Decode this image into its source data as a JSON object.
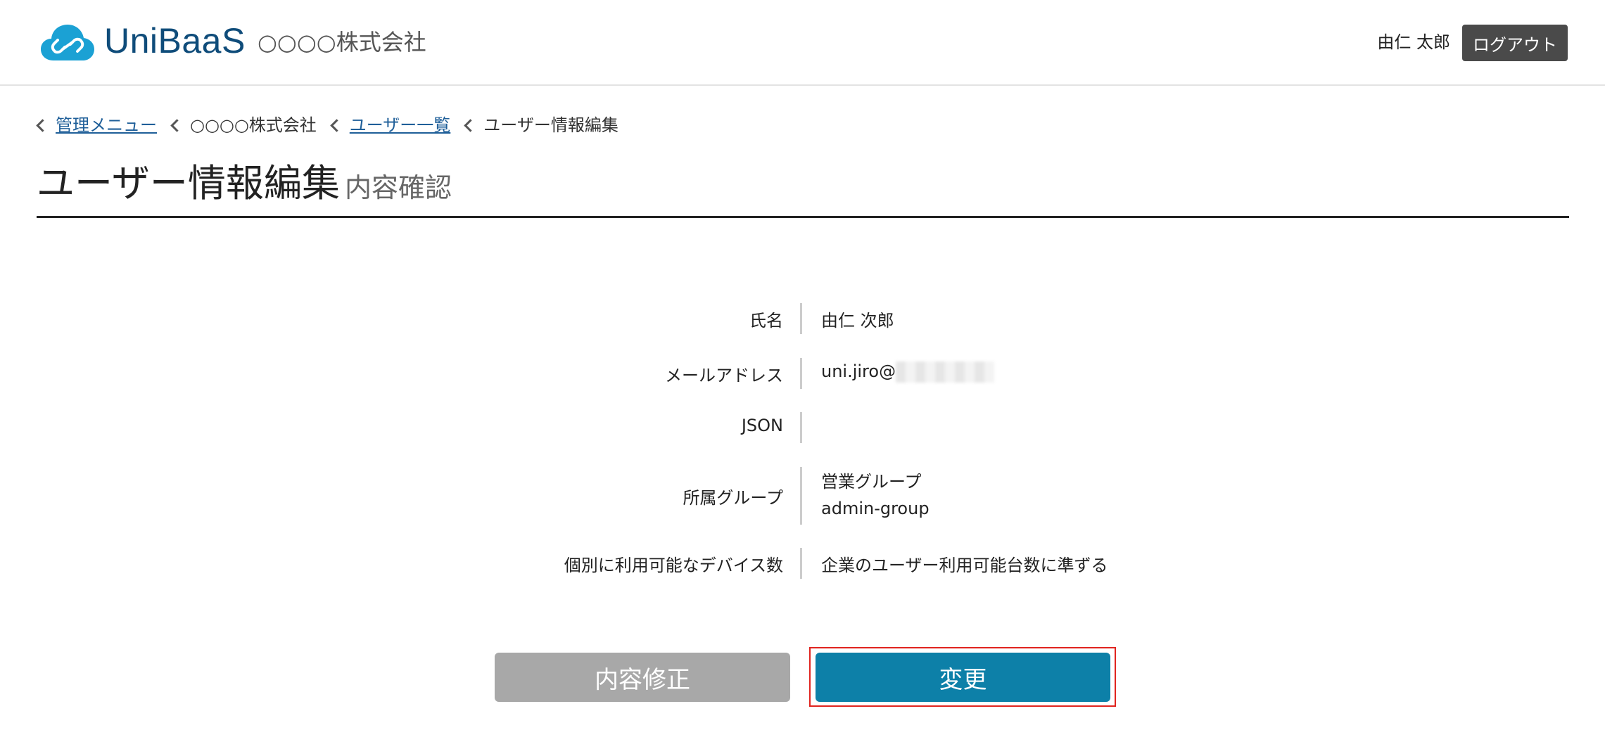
{
  "header": {
    "brand": "UniBaaS",
    "company": "○○○○株式会社",
    "user_name": "由仁 太郎",
    "logout_label": "ログアウト",
    "logo_icon": "cloud-link-icon",
    "brand_color": "#0f4c7a",
    "logo_color": "#1ba1d4"
  },
  "breadcrumb": [
    {
      "label": "管理メニュー",
      "link": true
    },
    {
      "label": "○○○○株式会社",
      "link": false
    },
    {
      "label": "ユーザー一覧",
      "link": true
    },
    {
      "label": "ユーザー情報編集",
      "link": false
    }
  ],
  "page": {
    "title": "ユーザー情報編集",
    "subtitle": "内容確認"
  },
  "details": {
    "name": {
      "label": "氏名",
      "value": "由仁 次郎"
    },
    "email": {
      "label": "メールアドレス",
      "value": "uni.jiro@"
    },
    "json": {
      "label": "JSON",
      "value": ""
    },
    "groups": {
      "label": "所属グループ",
      "values": [
        "営業グループ",
        "admin-group"
      ]
    },
    "devices": {
      "label": "個別に利用可能なデバイス数",
      "value": "企業のユーザー利用可能台数に準ずる"
    }
  },
  "actions": {
    "modify_label": "内容修正",
    "change_label": "変更",
    "modify_color": "#a8a8a8",
    "change_color": "#0d80a8",
    "highlight_color": "#e0241f"
  }
}
